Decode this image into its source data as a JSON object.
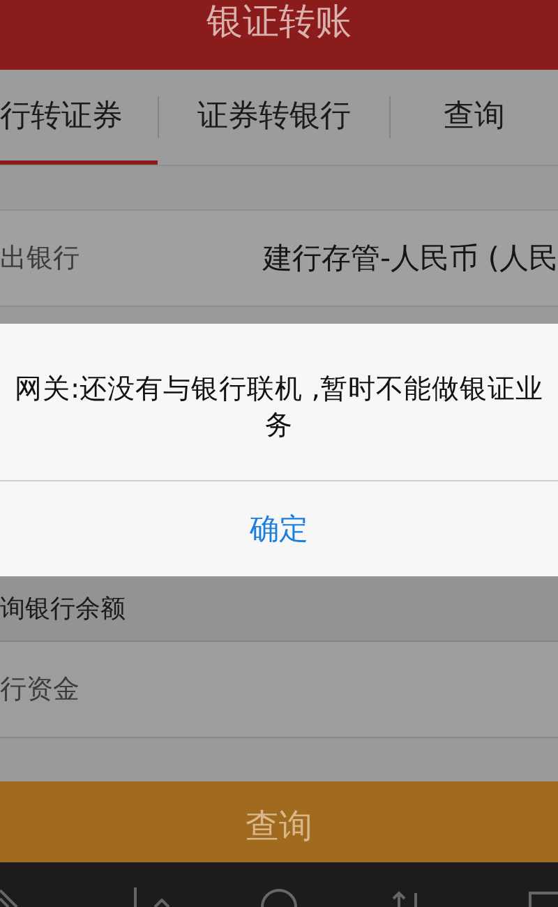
{
  "header": {
    "title": "银证转账"
  },
  "tabs": [
    {
      "label": "行转证券",
      "selected": true
    },
    {
      "label": "证券转银行",
      "selected": false
    },
    {
      "label": "查询",
      "selected": false
    }
  ],
  "transfer_row": {
    "label": "出银行",
    "value": "建行存管-人民币 (人民"
  },
  "dialog": {
    "message": "网关:还没有与银行联机 ,暂时不能做银证业务",
    "button": "确定"
  },
  "section": {
    "title": "询银行余额"
  },
  "balance_row": {
    "label": "行资金"
  },
  "query_button": "查询"
}
